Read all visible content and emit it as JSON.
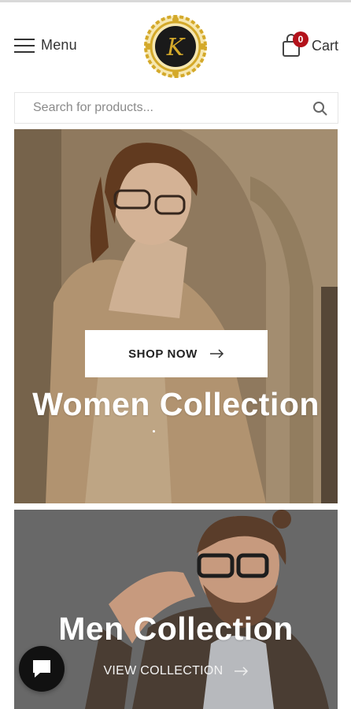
{
  "header": {
    "menu_label": "Menu",
    "logo_monogram": "K",
    "cart_label": "Cart",
    "cart_count": "0"
  },
  "search": {
    "placeholder": "Search for products..."
  },
  "banners": [
    {
      "title": "Women Collection",
      "button_label": "SHOP NOW"
    },
    {
      "title": "Men Collection",
      "button_label": "VIEW COLLECTION"
    }
  ],
  "colors": {
    "badge": "#b3121b",
    "logo_gold": "#d4a92a",
    "logo_dark": "#1a1a1a",
    "chat_bg": "#111111"
  },
  "icons": {
    "menu": "hamburger-icon",
    "cart": "shopping-bag-icon",
    "search": "search-icon",
    "arrow": "arrow-right-icon",
    "chat": "chat-bubble-icon"
  }
}
